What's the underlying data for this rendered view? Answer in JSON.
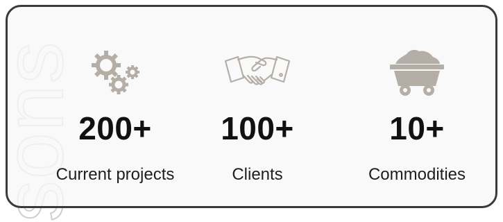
{
  "watermark": {
    "text": "sons"
  },
  "stats": [
    {
      "value": "200+",
      "label": "Current projects",
      "icon": "gears-icon"
    },
    {
      "value": "100+",
      "label": "Clients",
      "icon": "handshake-icon"
    },
    {
      "value": "10+",
      "label": "Commodities",
      "icon": "mine-cart-icon"
    }
  ],
  "colors": {
    "icon": "#b5aea6",
    "text": "#111111",
    "border": "#3a3a3a",
    "card_bg": "#f7f7f7"
  }
}
